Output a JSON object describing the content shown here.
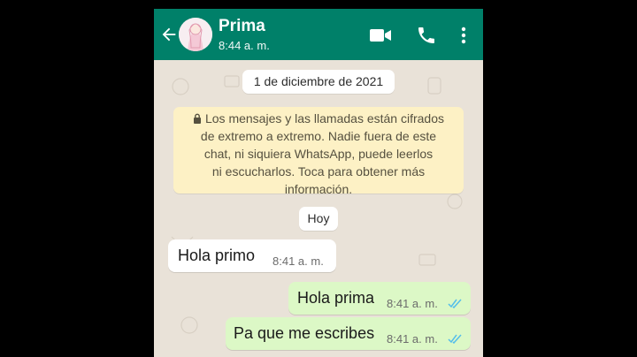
{
  "chat": {
    "contact_name": "Prima",
    "last_seen": "8:44 a. m."
  },
  "icons": {
    "back": "arrow-back-icon",
    "video": "video-call-icon",
    "call": "phone-call-icon",
    "menu": "more-vert-icon",
    "lock": "lock-icon",
    "read": "double-check-icon"
  },
  "colors": {
    "header": "#008069",
    "chat_bg": "#e9e2d8",
    "outgoing_bubble": "#dcf8c6",
    "notice_bg": "#fdf1c5",
    "read_ticks": "#53bdeb"
  },
  "date_chip": "1 de diciembre de 2021",
  "encryption_notice": "Los mensajes y las llamadas están cifrados\nde extremo a extremo. Nadie fuera de este\nchat, ni siquiera WhatsApp, puede leerlos\nni escucharlos. Toca para obtener más\ninformación.",
  "today_chip": "Hoy",
  "messages": [
    {
      "direction": "incoming",
      "text": "Hola primo",
      "time": "8:41 a. m."
    },
    {
      "direction": "outgoing",
      "text": "Hola prima",
      "time": "8:41 a. m.",
      "status": "read"
    },
    {
      "direction": "outgoing",
      "text": "Pa que me escribes",
      "time": "8:41 a. m.",
      "status": "read"
    }
  ]
}
